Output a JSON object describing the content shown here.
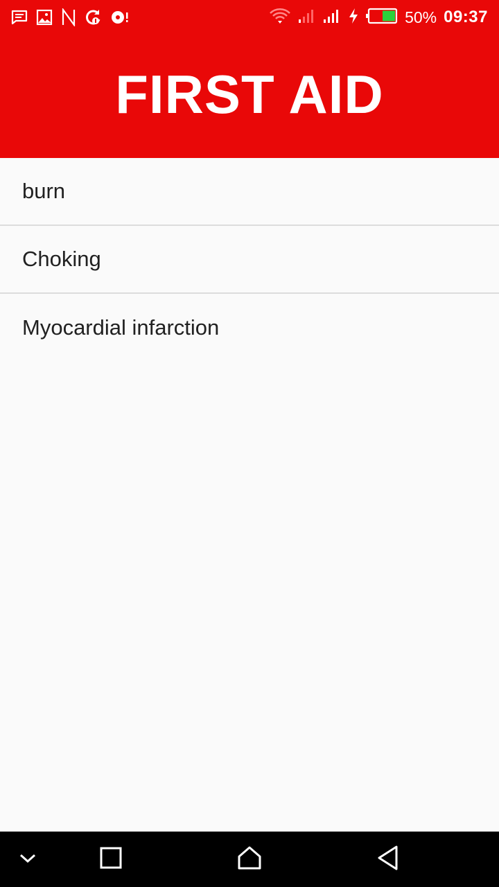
{
  "status_bar": {
    "left_icons": [
      "message-icon",
      "image-icon",
      "n-icon",
      "sync-icon",
      "media-icon"
    ],
    "right_icons": [
      "wifi-icon",
      "signal-weak-icon",
      "signal-icon",
      "charging-icon",
      "battery-icon"
    ],
    "battery_percent": "50%",
    "battery_level": 0.5,
    "time": "09:37"
  },
  "header": {
    "title": "FIRST AID",
    "color": "#e90808"
  },
  "list": {
    "items": [
      {
        "label": "burn"
      },
      {
        "label": "Choking"
      },
      {
        "label": "Myocardial infarction"
      }
    ]
  },
  "nav_bar": {
    "buttons": [
      "collapse-icon",
      "recents-icon",
      "home-icon",
      "back-icon"
    ]
  }
}
